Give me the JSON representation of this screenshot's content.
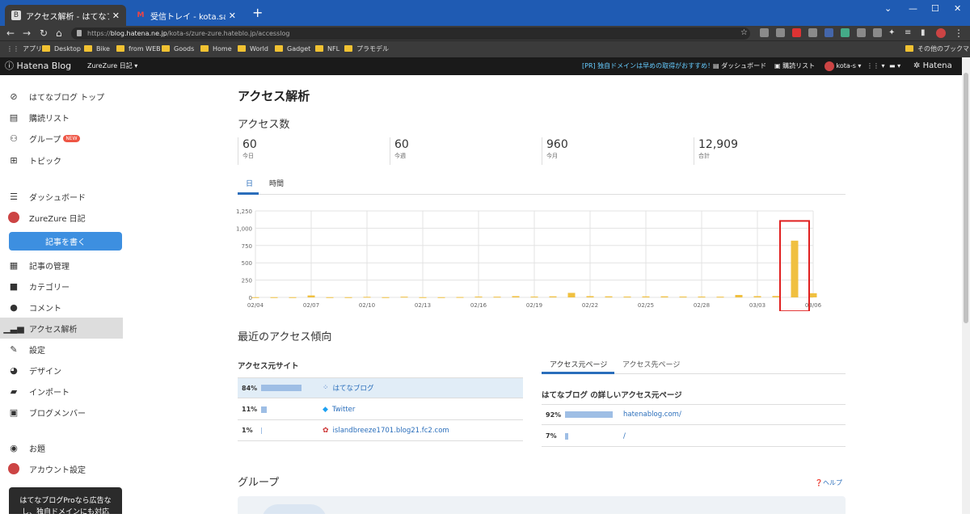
{
  "browser": {
    "tabs": [
      {
        "title": "アクセス解析 - はてなブログ",
        "active": true
      },
      {
        "title": "受信トレイ - kota.sakakibara@gm",
        "active": false
      }
    ],
    "url_scheme": "https://",
    "url_host": "blog.hatena.ne.jp",
    "url_path": "/kota-s/zure-zure.hateblo.jp/accesslog",
    "bookmarks": [
      "アプリ",
      "Desktop",
      "Bike",
      "from WEB",
      "Goods",
      "Home",
      "World",
      "Gadget",
      "NFL",
      "プラモデル"
    ],
    "other_bookmarks": "その他のブックマーク"
  },
  "hatena_bar": {
    "logo": "Hatena Blog",
    "blog_name": "ZureZure 日記",
    "promo": "[PR] 独自ドメインは早めの取得がおすすめ！",
    "dashboard": "ダッシュボード",
    "reading_list": "購読リスト",
    "user": "kota-s",
    "hatena": "Hatena"
  },
  "sidebar": {
    "items": [
      {
        "label": "はてなブログ トップ",
        "icon": "hatena-top-icon"
      },
      {
        "label": "購読リスト",
        "icon": "reading-list-icon"
      },
      {
        "label": "グループ",
        "icon": "group-icon",
        "badge": "NEW"
      },
      {
        "label": "トピック",
        "icon": "topic-icon"
      },
      {
        "label": "ダッシュボード",
        "icon": "dashboard-icon"
      },
      {
        "label": "ZureZure 日記",
        "icon": "blog-avatar-icon"
      },
      {
        "label": "記事の管理",
        "icon": "article-icon"
      },
      {
        "label": "カテゴリー",
        "icon": "folder-icon"
      },
      {
        "label": "コメント",
        "icon": "comment-icon"
      },
      {
        "label": "アクセス解析",
        "icon": "analytics-icon"
      },
      {
        "label": "設定",
        "icon": "wrench-icon"
      },
      {
        "label": "デザイン",
        "icon": "palette-icon"
      },
      {
        "label": "インポート",
        "icon": "truck-icon"
      },
      {
        "label": "ブログメンバー",
        "icon": "member-icon"
      },
      {
        "label": "お題",
        "icon": "question-icon"
      },
      {
        "label": "アカウント設定",
        "icon": "account-icon"
      }
    ],
    "write_button": "記事を書く",
    "promo_line1": "はてなブログProなら広告な",
    "promo_line2": "し、独自ドメインにも対応"
  },
  "main": {
    "title": "アクセス解析",
    "access_heading": "アクセス数",
    "stats": [
      {
        "value": "60",
        "label": "今日"
      },
      {
        "value": "60",
        "label": "今週"
      },
      {
        "value": "960",
        "label": "今月"
      },
      {
        "value": "12,909",
        "label": "合計"
      }
    ],
    "tabs": [
      "日",
      "時間"
    ],
    "trend_heading": "最近のアクセス傾向",
    "source_sites_heading": "アクセス元サイト",
    "source_sites": [
      {
        "pct": "84%",
        "ratio": 0.84,
        "name": "はてなブログ",
        "icon": "hatena-icon"
      },
      {
        "pct": "11%",
        "ratio": 0.11,
        "name": "Twitter",
        "icon": "twitter-icon"
      },
      {
        "pct": "1%",
        "ratio": 0.01,
        "name": "islandbreeze1701.blog21.fc2.com",
        "icon": "fc2-icon"
      }
    ],
    "page_tabs": [
      "アクセス元ページ",
      "アクセス先ページ"
    ],
    "pages_subheading": "はてなブログ の詳しいアクセス元ページ",
    "source_pages": [
      {
        "pct": "92%",
        "ratio": 0.92,
        "name": "hatenablog.com/"
      },
      {
        "pct": "7%",
        "ratio": 0.07,
        "name": "/"
      }
    ],
    "group_heading": "グループ",
    "help": "ヘルプ"
  },
  "chart_data": {
    "type": "bar",
    "x": [
      "02/04",
      "02/05",
      "02/06",
      "02/07",
      "02/08",
      "02/09",
      "02/10",
      "02/11",
      "02/12",
      "02/13",
      "02/14",
      "02/15",
      "02/16",
      "02/17",
      "02/18",
      "02/19",
      "02/20",
      "02/21",
      "02/22",
      "02/23",
      "02/24",
      "02/25",
      "02/26",
      "02/27",
      "02/28",
      "03/01",
      "03/02",
      "03/03",
      "03/04",
      "03/05",
      "03/06"
    ],
    "values": [
      3,
      3,
      3,
      28,
      3,
      3,
      8,
      3,
      10,
      3,
      3,
      5,
      12,
      10,
      18,
      12,
      15,
      65,
      18,
      15,
      12,
      14,
      15,
      12,
      12,
      10,
      35,
      18,
      20,
      820,
      60
    ],
    "xticks": [
      "02/04",
      "02/07",
      "02/10",
      "02/13",
      "02/16",
      "02/19",
      "02/22",
      "02/25",
      "02/28",
      "03/03",
      "03/06"
    ],
    "yticks": [
      "0",
      "250",
      "500",
      "750",
      "1,000",
      "1,250"
    ],
    "ylim": [
      0,
      1250
    ],
    "bar_color": "#f0c040",
    "highlight_index": 29,
    "highlight_color": "#e02020",
    "grid": true
  }
}
